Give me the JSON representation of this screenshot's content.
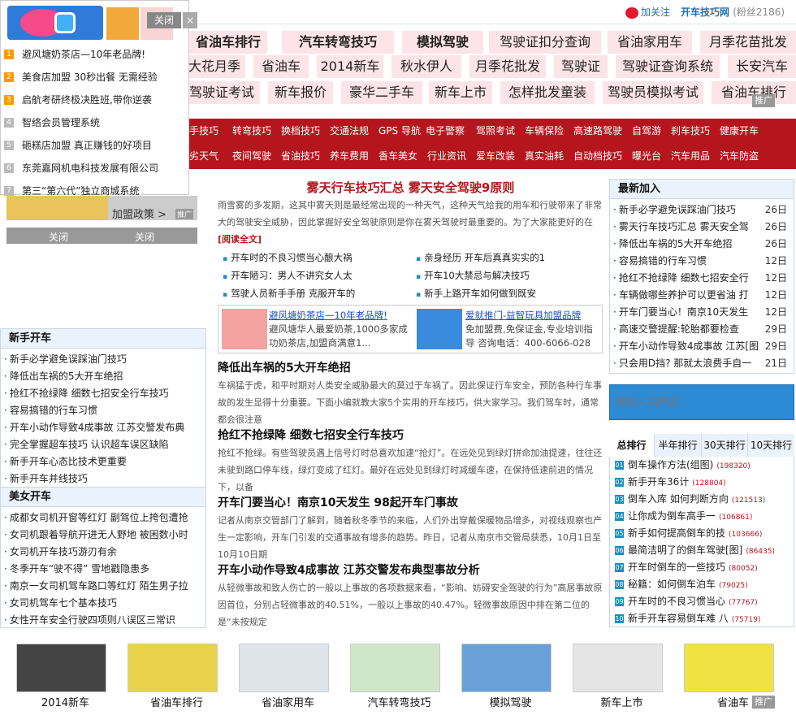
{
  "header": {
    "follow_label": "加关注",
    "brand": "开车技巧网",
    "fans": "(粉丝2186)"
  },
  "keywords": {
    "row1": [
      "省油车排行",
      "汽车转弯技巧",
      "模拟驾驶",
      "驾驶证扣分查询",
      "省油家用车",
      "月季花苗批发"
    ],
    "row2": [
      "大花月季",
      "省油车",
      "2014新车",
      "秋水伊人",
      "月季花批发",
      "驾驶证",
      "驾驶证查询系统",
      "长安汽车"
    ],
    "row3": [
      "驾驶证考试",
      "新车报价",
      "豪华二手车",
      "新车上市",
      "怎样批发童装",
      "驾驶员模拟考试",
      "省油车排行"
    ],
    "ad_label": "推广"
  },
  "nav": {
    "row1": [
      "手技巧",
      "转弯技巧",
      "换档技巧",
      "交通法规",
      "GPS 导航",
      "电子警察",
      "驾照考试",
      "车辆保险",
      "高速路驾驶",
      "自驾游",
      "刹车技巧",
      "健康开车"
    ],
    "row2": [
      "劣天气",
      "夜间驾驶",
      "省油技巧",
      "养车费用",
      "香车美女",
      "行业资讯",
      "爱车改装",
      "真实油耗",
      "自动档技巧",
      "曝光台",
      "汽车用品",
      "汽车防盗"
    ]
  },
  "popup": {
    "close_label": "关闭",
    "close_x": "×",
    "items": [
      "避风塘奶茶店—10年老品牌!",
      "美食店加盟 30秒出餐 无需经验",
      "启航考研终极决胜班,带你逆袭",
      "智络会员管理系统",
      "砸糕店加盟 真正赚钱的好项目",
      "东莞嘉网机电科技发展有限公司",
      "第三“第六代”独立商城系统"
    ],
    "nums": [
      "1",
      "2",
      "3",
      "4",
      "5",
      "6",
      "7"
    ],
    "bottom_text": "加盟政策 >",
    "bottom_ad": "推广",
    "close1": "关闭",
    "close2": "关闭"
  },
  "left": {
    "newbie_title": "新手开车",
    "newbie": [
      "新手必学避免误踩油门技巧",
      "降低出车祸的5大开车绝招",
      "抢红不抢绿降 细数七招安全行车技巧",
      "容易搞错的行车习惯",
      "开车小动作导致4成事故 江苏交警发布典",
      "完全掌握超车技巧 认识超车误区缺陷",
      "新手开车心态比技术更重要",
      "新手开车并线技巧"
    ],
    "beauty_title": "美女开车",
    "beauty": [
      "成都女司机开窗等红灯 副驾位上挎包遭抢",
      "女司机跟着导航开进无人野地 被困数小时",
      "女司机开车技巧游刃有余",
      "冬季开车“驶不得” 雪地戳隐患多",
      "南京一女司机驾车路口等红灯 陌生男子拉",
      "女司机驾车七个基本技巧",
      "女性开车安全行驶四项则八误区三常识"
    ]
  },
  "main": {
    "headline": "雾天行车技巧汇总 雾天安全驾驶9原则",
    "intro": "雨雪雾的多发期，这其中雾天则是最经常出现的一种天气，这种天气给我的用车和行驶带来了非常大的驾驶安全威胁，因此掌握好安全驾驶原则是你在雾天驾驶时最重要的。为了大家能更好的在",
    "read_more": "[阅读全文]",
    "links_left": [
      "开车时的不良习惯当心酿大祸",
      "开车陋习：男人不讲究女人太",
      "驾驶人员新手手册 克服开车的"
    ],
    "links_right": [
      "亲身经历 开车后真真实实的1",
      "开车10大禁忌与解决技巧",
      "新手上路开车如何做到既安"
    ],
    "ad1_title": "避风塘奶茶店—10年老品牌!",
    "ad1_desc": "避风塘华人最爱奶茶,1000多家成功奶茶店,加盟商满意1...",
    "ad2_title": "爱就推门-益智玩具加盟品牌",
    "ad2_desc": "免加盟费,免保证金,专业培训指导 咨询电话：400-6066-028",
    "articles": [
      {
        "title": "降低出车祸的5大开车绝招",
        "body": "车祸猛于虎，和平时期对人类安全威胁最大的莫过于车祸了。因此保证行车安全，预防各种行车事故的发生显得十分重要。下面小编就教大家5个实用的开车技巧，供大家学习。我们驾车时，通常都会很注意"
      },
      {
        "title": "抢红不抢绿降 细数七招安全行车技巧",
        "body": "抢红不抢绿。有些驾驶员遇上信号灯时总喜欢加速“抢灯”。在远处见到绿灯拼命加油提速，往往还未驶到路口停车线，绿灯变成了红灯。最好在远处见到绿灯时减缓车速，在保持低速前进的情况下，以备"
      },
      {
        "title": "开车门要当心！南京10天发生 98起开车门事故",
        "body": "记者从南京交管部门了解到，随着秋冬季节的来临，人们外出穿戴保暖物品增多，对视线观察也产生一定影响，开车门引发的交通事故有增多的趋势。昨日，记者从南京市交管局获悉，10月1日至10月10日期"
      },
      {
        "title": "开车小动作导致4成事故 江苏交警发布典型事故分析",
        "body": "从轻微事故和致人伤亡的一般以上事故的各项数据来看，“影响、妨碍安全驾驶的行为”高居事故原因首位，分别占轻微事故的40.51%，一般以上事故的40.47%。轻微事故原因中排在第二位的是“未按规定"
      }
    ]
  },
  "right": {
    "new_title": "最新加入",
    "new_items": [
      {
        "t": "新手必学避免误踩油门技巧",
        "d": "26日"
      },
      {
        "t": "雾天行车技巧汇总 雾天安全驾",
        "d": "26日"
      },
      {
        "t": "降低出车祸的5大开车绝招",
        "d": "26日"
      },
      {
        "t": "容易搞错的行车习惯",
        "d": "12日"
      },
      {
        "t": "抢红不抢绿降 细数七招安全行",
        "d": "12日"
      },
      {
        "t": "车辆做哪些养护可以更省油 打",
        "d": "12日"
      },
      {
        "t": "开车门要当心！南京10天发生",
        "d": "12日"
      },
      {
        "t": "高速交警提醒:轮胎都要检查",
        "d": "29日"
      },
      {
        "t": "开车小动作导致4成事故 江苏[图",
        "d": "29日"
      },
      {
        "t": "只会用D挡? 那就太浪费手自一",
        "d": "21日"
      }
    ],
    "search_placeholder": "请输入关键词",
    "rank_tabs": [
      "总排行",
      "半年排行",
      "30天排行",
      "10天排行"
    ],
    "ranks": [
      {
        "n": "01",
        "t": "倒车操作方法(组图)",
        "c": "(198320)"
      },
      {
        "n": "02",
        "t": "新手开车36计",
        "c": "(128804)"
      },
      {
        "n": "03",
        "t": "倒车入库 如何判断方向",
        "c": "(121513)"
      },
      {
        "n": "04",
        "t": "让你成为倒车高手一",
        "c": "(106861)"
      },
      {
        "n": "05",
        "t": "新手如何提高倒车的技",
        "c": "(103666)"
      },
      {
        "n": "06",
        "t": "最简洁明了的倒车驾驶[图]",
        "c": "(86435)"
      },
      {
        "n": "07",
        "t": "开车时倒车的一些技巧",
        "c": "(80052)"
      },
      {
        "n": "08",
        "t": "秘籍：如何倒车泊车",
        "c": "(79025)"
      },
      {
        "n": "09",
        "t": "开车时的不良习惯当心",
        "c": "(77767)"
      },
      {
        "n": "10",
        "t": "新手开车容易倒车难 八",
        "c": "(75719)"
      }
    ]
  },
  "bottom": {
    "items": [
      "2014新车",
      "省油车排行",
      "省油家用车",
      "汽车转弯技巧",
      "模拟驾驶",
      "新车上市",
      "省油车"
    ],
    "colors": [
      "#444",
      "#e8d24a",
      "#dfe3ea",
      "#cfe6c9",
      "#6aa0d8",
      "#e5e5e5",
      "#f1e243"
    ],
    "ad_label": "推广"
  }
}
